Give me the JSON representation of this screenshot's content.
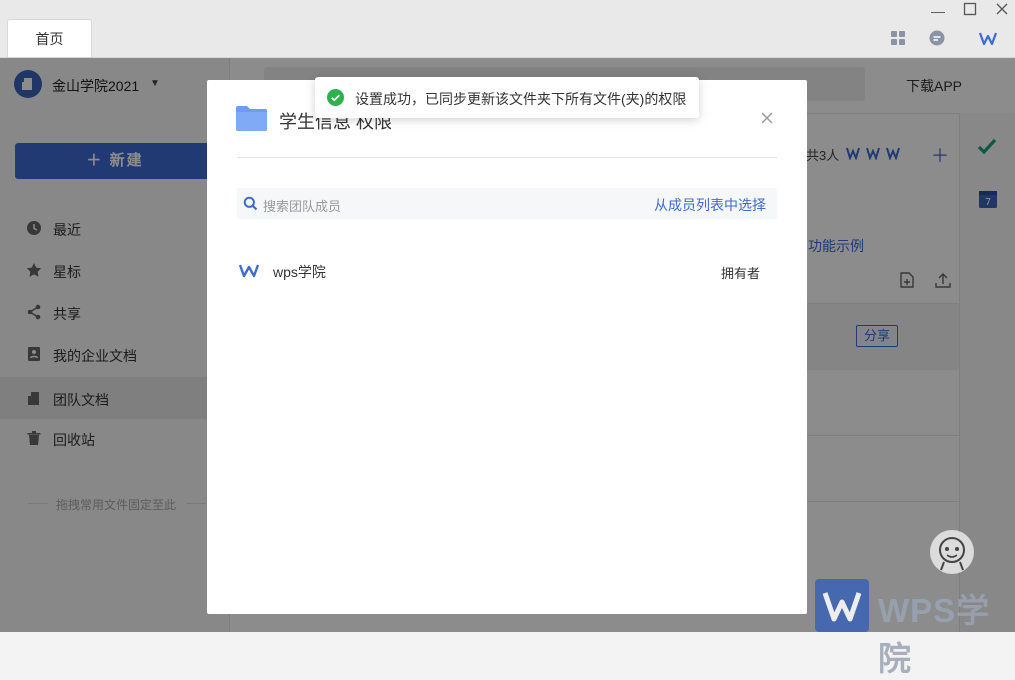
{
  "titlebar": {
    "tab_label": "首页"
  },
  "header": {
    "org_name": "金山学院2021",
    "download_app": "下载APP"
  },
  "sidebar": {
    "new_button": "新建",
    "items": [
      {
        "label": "最近",
        "icon": "clock-icon"
      },
      {
        "label": "星标",
        "icon": "star-icon"
      },
      {
        "label": "共享",
        "icon": "share-icon"
      },
      {
        "label": "我的企业文档",
        "icon": "document-icon"
      },
      {
        "label": "团队文档",
        "icon": "team-folder-icon"
      },
      {
        "label": "回收站",
        "icon": "trash-icon"
      }
    ],
    "hint": "拖拽常用文件固定至此"
  },
  "main": {
    "member_count": "共3人",
    "example_link": "功能示例",
    "share_button": "分享"
  },
  "dialog": {
    "title": "学生信息 权限",
    "search_placeholder": "搜索团队成员",
    "pick_from_list": "从成员列表中选择",
    "members": [
      {
        "name": "wps学院",
        "role": "拥有者"
      }
    ]
  },
  "toast": {
    "message": "设置成功，已同步更新该文件夹下所有文件(夹)的权限"
  },
  "watermark": {
    "text": "WPS学院"
  },
  "colors": {
    "accent": "#3d6bd1",
    "success": "#2bb24c",
    "folder": "#6f9cf2"
  }
}
